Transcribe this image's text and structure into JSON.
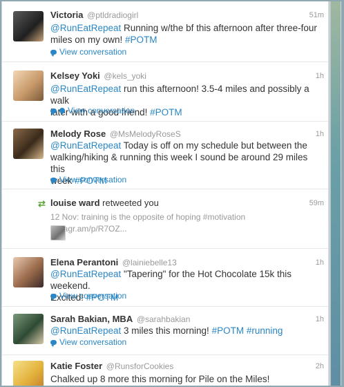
{
  "tweets": [
    {
      "name": "Victoria",
      "handle": "@ptldradiogirl",
      "time": "51m",
      "mention": "@RunEatRepeat",
      "text1": " Running w/the bf this afternoon after three-four",
      "text2": "miles on my own! ",
      "hashtag": "#POTM",
      "convo": "View conversation",
      "avatar_color": "#3b3b3b"
    },
    {
      "name": "Kelsey Yoki",
      "handle": "@kels_yoki",
      "time": "1h",
      "mention": "@RunEatRepeat",
      "text1": " run this afternoon! 3.5-4 miles and possibly a walk",
      "text2": "later with a good friend! ",
      "hashtag": "#POTM",
      "convo": "View conversation",
      "avatar_color": "#d9b48a"
    },
    {
      "name": "Melody Rose",
      "handle": "@MsMelodyRoseS",
      "time": "1h",
      "mention": "@RunEatRepeat",
      "text1": " Today is off on my schedule but between the",
      "text2": "walking/hiking & running this week I sound be around 29 miles this",
      "text3": "week ",
      "hashtag": "#POTM",
      "convo": "View conversation",
      "avatar_color": "#6b4a2e"
    },
    {
      "name": "louise ward",
      "retweet_text": "retweeted you",
      "time": "59m",
      "muted": "12 Nov: training is the opposite of hoping #motivation instagr.am/p/R7OZ..."
    },
    {
      "name": "Elena Perantoni",
      "handle": "@lainiebelle13",
      "time": "1h",
      "mention": "@RunEatRepeat",
      "text1": " \"Tapering\" for the Hot Chocolate 15k this weekend.",
      "text2": "Excited! ",
      "hashtag": "#POTM",
      "convo": "View conversation",
      "avatar_color": "#b07c5a"
    },
    {
      "name": "Sarah Bakian, MBA",
      "handle": "@sarahbakian",
      "time": "1h",
      "mention": "@RunEatRepeat",
      "text1": " 3 miles this morning! ",
      "hashtag": "#POTM",
      "hashtag2": "#running",
      "convo": "View conversation",
      "avatar_color": "#4e6e55"
    },
    {
      "name": "Katie Foster",
      "handle": "@RunsforCookies",
      "time": "2h",
      "text1": "Chalked up 8 more this morning for Pile on the Miles!",
      "avatar_color": "#e3b23c"
    }
  ],
  "colors": {
    "link": "#2a86c4",
    "retweet": "#5fa43a",
    "muted": "#999999"
  },
  "icons": {
    "conversation": "speech-bubble-icon",
    "location": "location-pin-icon",
    "retweet": "retweet-icon"
  }
}
